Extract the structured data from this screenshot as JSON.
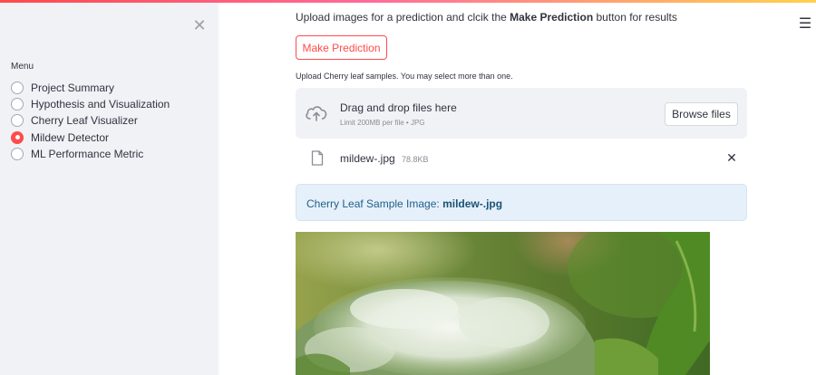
{
  "sidebar": {
    "menu_label": "Menu",
    "items": [
      {
        "label": "Project Summary",
        "selected": false
      },
      {
        "label": "Hypothesis and Visualization",
        "selected": false
      },
      {
        "label": "Cherry Leaf Visualizer",
        "selected": false
      },
      {
        "label": "Mildew Detector",
        "selected": true
      },
      {
        "label": "ML Performance Metric",
        "selected": false
      }
    ],
    "close_icon": "close-icon"
  },
  "header": {
    "menu_icon": "hamburger-menu-icon",
    "accent_gradient": [
      "#ff4b4b",
      "#ff6b9a",
      "#ffd24d"
    ]
  },
  "main": {
    "intro_prefix": "Upload images for a prediction and clcik the ",
    "intro_bold": "Make Prediction",
    "intro_suffix": " button for results",
    "predict_button_label": "Make Prediction",
    "upload_label": "Upload Cherry leaf samples. You may select more than one.",
    "dropzone": {
      "title": "Drag and drop files here",
      "subtitle": "Limit 200MB per file • JPG",
      "browse_label": "Browse files",
      "icon": "cloud-upload-icon"
    },
    "uploaded_file": {
      "name": "mildew-.jpg",
      "size": "78.8KB",
      "icon": "file-icon",
      "remove_icon": "close-icon"
    },
    "info": {
      "prefix": "Cherry Leaf Sample Image: ",
      "filename": "mildew-.jpg"
    },
    "image": "cherry-leaf-powdery-mildew-photo"
  },
  "colors": {
    "accent": "#ff4b4b",
    "sidebar_bg": "#f0f2f6",
    "info_bg": "#e6f0fa",
    "info_text": "#1f5f8a"
  }
}
